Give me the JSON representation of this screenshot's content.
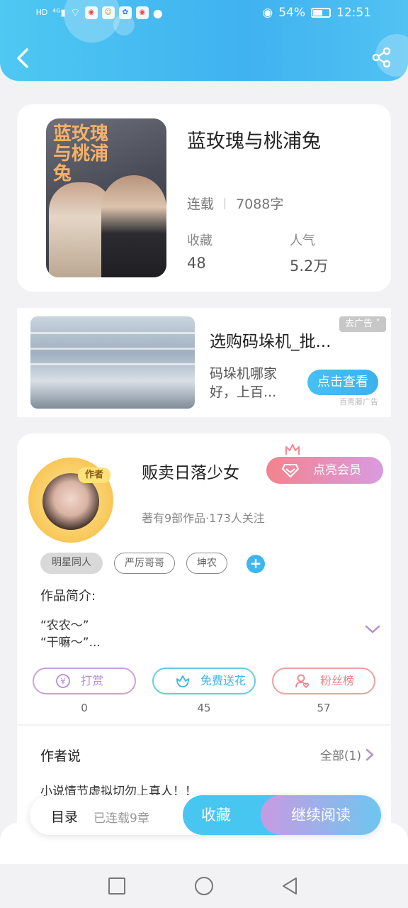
{
  "status_bar": {
    "left_icons": [
      "hd-icon",
      "4g-signal-icon",
      "wifi-icon",
      "weibo-icon",
      "app-icon",
      "baidu-icon",
      "weibo-icon",
      "chat-icon"
    ],
    "battery_percent": "54%",
    "time": "12:51"
  },
  "header": {
    "back_icon": "chevron-left-icon",
    "share_icon": "share-icon"
  },
  "book": {
    "cover_text": "蓝玫瑰与桃浦兔",
    "title": "蓝玫瑰与桃浦兔",
    "status": "连载",
    "word_count": "7088字",
    "favorites_label": "收藏",
    "favorites_value": "48",
    "popularity_label": "人气",
    "popularity_value": "5.2万"
  },
  "ad": {
    "title": "选购码垛机_批...",
    "desc_line1": "码垛机哪家",
    "desc_line2": "好，上百...",
    "button": "点击查看",
    "tag": "去广告",
    "source": "百青藤广告"
  },
  "author": {
    "badge": "作者",
    "name": "贩卖日落少女",
    "vip_button": "点亮会员",
    "meta": "著有9部作品·173人关注",
    "tags": [
      "明星同人",
      "严厉哥哥",
      "坤农"
    ],
    "intro_label": "作品简介:",
    "intro_line1": "“农农～”",
    "intro_line2": "“干嘛～”..."
  },
  "actions": {
    "tip_label": "打赏",
    "tip_count": "0",
    "flower_label": "免费送花",
    "flower_count": "45",
    "fans_label": "粉丝榜",
    "fans_count": "57"
  },
  "author_says": {
    "title": "作者说",
    "all": "全部(1)",
    "text": "小说情节虚拟切勿上真人！！"
  },
  "bottom_bar": {
    "toc": "目录",
    "toc_sub": "已连载9章",
    "collect": "收藏",
    "read": "继续阅读"
  },
  "colors": {
    "header": "#3fb2f0",
    "accent_blue": "#48c6f2",
    "vip_pink": "#f3838d",
    "purple": "#c79be3"
  }
}
